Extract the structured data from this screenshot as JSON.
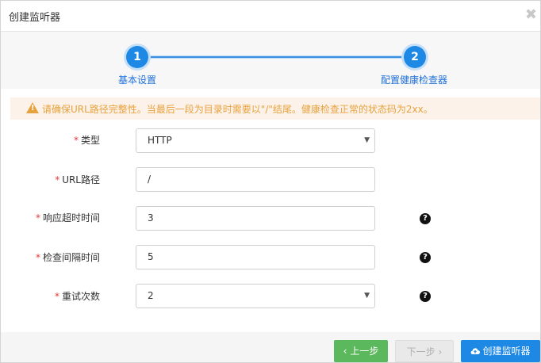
{
  "dialog": {
    "title": "创建监听器",
    "close_glyph": "✖"
  },
  "steps": [
    {
      "number": "1",
      "label": "基本设置"
    },
    {
      "number": "2",
      "label": "配置健康检查器"
    }
  ],
  "warning": {
    "icon": "warning-icon",
    "icon_glyph": "!",
    "text": "请确保URL路径完整性。当最后一段为目录时需要以\"/\"结尾。健康检查正常的状态码为2xx。"
  },
  "form": {
    "required_mark": "*",
    "type": {
      "label": "类型",
      "value": "HTTP"
    },
    "url_path": {
      "label": "URL路径",
      "value": "/"
    },
    "timeout": {
      "label": "响应超时时间",
      "value": "3"
    },
    "interval": {
      "label": "检查间隔时间",
      "value": "5"
    },
    "retries": {
      "label": "重试次数",
      "value": "2"
    },
    "help_glyph": "?",
    "caret_glyph": "▼"
  },
  "footer": {
    "prev_label": "上一步",
    "prev_icon": "‹",
    "next_label": "下一步",
    "next_icon": "›",
    "create_label": "创建监听器"
  },
  "colors": {
    "primary": "#1e88e5",
    "success": "#5cb85c",
    "warning": "#e6a23c",
    "required": "#e53935"
  }
}
